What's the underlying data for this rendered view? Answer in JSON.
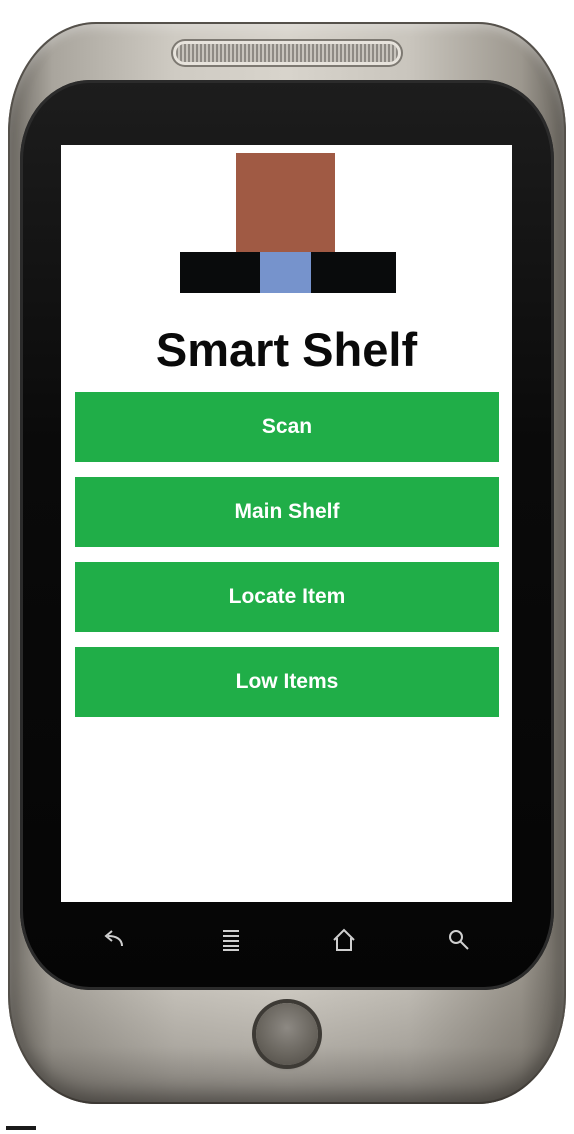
{
  "app": {
    "title": "Smart Shelf"
  },
  "logo": {
    "colors": {
      "top_block": "#a05a44",
      "bar_dark": "#090b0c",
      "bar_center": "#7693cc"
    }
  },
  "menu": {
    "buttons": [
      {
        "label": "Scan"
      },
      {
        "label": "Main Shelf"
      },
      {
        "label": "Locate Item"
      },
      {
        "label": "Low Items"
      }
    ],
    "button_color": "#20ae48"
  },
  "softkeys": {
    "icons": [
      "back-icon",
      "menu-icon",
      "home-icon",
      "search-icon"
    ]
  }
}
